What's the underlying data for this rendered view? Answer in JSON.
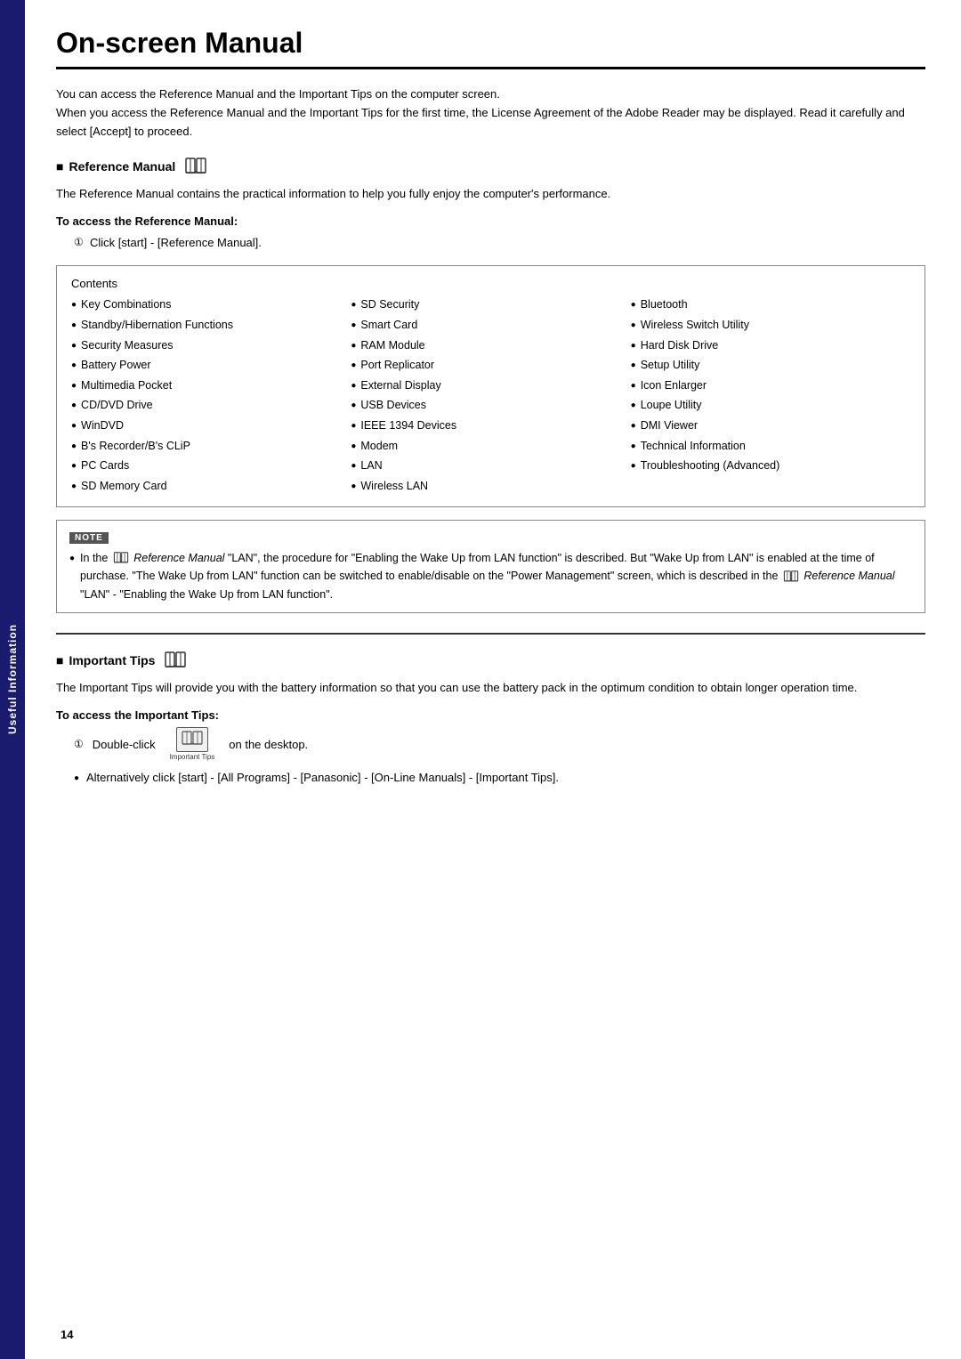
{
  "sidebar": {
    "label": "Useful Information"
  },
  "page": {
    "title": "On-screen Manual",
    "page_number": "14",
    "intro_lines": [
      "You can access the Reference Manual and the Important Tips on the computer screen.",
      "When you access the Reference Manual and the Important Tips for the first time, the License Agreement of the Adobe Reader may be displayed. Read it carefully and select [Accept] to proceed."
    ]
  },
  "reference_manual": {
    "heading": "Reference Manual",
    "description": "The Reference Manual contains the practical information to help you fully enjoy the computer's performance.",
    "access_heading": "To access the Reference Manual:",
    "step": "Click [start] - [Reference Manual].",
    "contents_title": "Contents",
    "col1": [
      "Key Combinations",
      "Standby/Hibernation Functions",
      "Security Measures",
      "Battery Power",
      "Multimedia Pocket",
      "CD/DVD Drive",
      "WinDVD",
      "B's Recorder/B's CLiP",
      "PC Cards",
      "SD Memory Card"
    ],
    "col2": [
      "SD Security",
      "Smart Card",
      "RAM Module",
      "Port Replicator",
      "External Display",
      "USB Devices",
      "IEEE 1394 Devices",
      "Modem",
      "LAN",
      "Wireless LAN"
    ],
    "col3": [
      "Bluetooth",
      "Wireless Switch Utility",
      "Hard Disk Drive",
      "Setup Utility",
      "Icon Enlarger",
      "Loupe Utility",
      "DMI Viewer",
      "Technical Information",
      "Troubleshooting (Advanced)"
    ],
    "note_label": "NOTE",
    "note_text_parts": [
      "In the ",
      " Reference Manual",
      " \"LAN\", the procedure for \"Enabling the Wake Up from LAN function\" is described. But \"Wake Up from LAN\" is enabled at the time of purchase. \"The Wake Up from LAN\" function can be switched to enable/disable on the \"Power Management\" screen, which is described in the ",
      " Reference Manual",
      " \"LAN\" - \"Enabling the Wake Up from LAN function\"."
    ]
  },
  "important_tips": {
    "heading": "Important Tips",
    "description": "The Important Tips will provide you with the battery information so that you can use the battery pack in the optimum condition to obtain longer operation time.",
    "access_heading": "To access the Important Tips:",
    "step_text": "Double-click",
    "step_suffix": "on the desktop.",
    "icon_label": "Important Tips",
    "bullet": "Alternatively click [start] - [All Programs] - [Panasonic] - [On-Line Manuals] - [Important Tips]."
  }
}
